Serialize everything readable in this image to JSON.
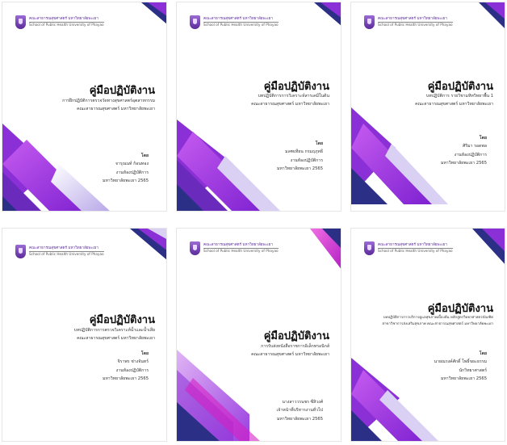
{
  "logo": {
    "name_th": "คณะสาธารณสุขศาสตร์ มหาวิทยาลัยพะเยา",
    "name_en": "School of Public Health University of Phayao"
  },
  "colors": {
    "purple": "#8b2fd6",
    "violet": "#b04be8",
    "navy": "#2c2f86",
    "magenta": "#d61fc5"
  },
  "cards": [
    {
      "title": "คู่มือปฏิบัติงาน",
      "subtitle": [
        "การฝึกปฏิบัติการตรวจวัดทางสุขศาสตร์อุตสาหกรรม",
        "คณะสาธารณสุขศาสตร์ มหาวิทยาลัยพะเยา"
      ],
      "by_label": "โดย",
      "by": [
        "จารุณนท์ ก้อนทอง",
        "งานห้องปฏิบัติการ",
        "มหาวิทยาลัยพะเยา 2565"
      ]
    },
    {
      "title": "คู่มือปฏิบัติงาน",
      "subtitle": [
        "บทปฏิบัติการการวิเคราะห์สารเคมีในดิน",
        "คณะสาธารณสุขศาสตร์ มหาวิทยาลัยพะเยา"
      ],
      "by_label": "โดย",
      "by": [
        "มลฑเทียน กรมฤภุทธี",
        "งานห้องปฏิบัติการ",
        "มหาวิทยาลัยพะเยา 2565"
      ]
    },
    {
      "title": "คู่มือปฏิบัติงาน",
      "subtitle": [
        "บทปฏิบัติการ รายวิชามหิทวิทยาพื้น 1",
        "คณะสาธารณสุขศาสตร์ มหาวิทยาลัยพะเยา"
      ],
      "by_label": "โดย",
      "by": [
        "ศิริมา รอดพล",
        "งานห้องปฏิบัติการ",
        "มหาวิทยาลัยพะเยา 2565"
      ]
    },
    {
      "title": "คู่มือปฏิบัติงาน",
      "subtitle": [
        "บทปฏิบัติการการตรวจวิเคราะห์น้ำและน้ำเสีย",
        "คณะสาธารณสุขศาสตร์ มหาวิทยาลัยพะเยา"
      ],
      "by_label": "โดย",
      "by": [
        "จิราพร ช่างจันทร์",
        "งานห้องปฏิบัติการ",
        "มหาวิทยาลัยพะเยา 2565"
      ]
    },
    {
      "title": "คู่มือปฏิบัติงาน",
      "subtitle": [
        "การรับส่งหนังสือราชการอิเล็กทรอนิกส์",
        "คณะสาธารณสุขศาสตร์ มหาวิทยาลัยพะเยา"
      ],
      "by_label": "",
      "by": [
        "นางสาววรนชร ซีสิวงศ์",
        "เจ้าหน้าที่บริหารงานทั่วไป",
        "มหาวิทยาลัยพะเยา 2565"
      ]
    },
    {
      "title": "คู่มือปฏิบัติงาน",
      "subtitle": [
        "บทปฏิบัติการการบริการดูแลสุขภาพเบื้องต้น หลักสูตรวิทยาศาสตรบัณฑิต",
        "สาขาวิชาการส่งเสริมสุขภาพ คณะสาธารณสุขศาสตร์ มหาวิทยาลัยพะเยา"
      ],
      "by_label": "โดย",
      "by": [
        "นายณรงค์ศักดิ์ โพธิ์ขยะธรรม",
        "นักวิทยาศาสตร์",
        "มหาวิทยาลัยพะเยา 2565"
      ]
    }
  ]
}
